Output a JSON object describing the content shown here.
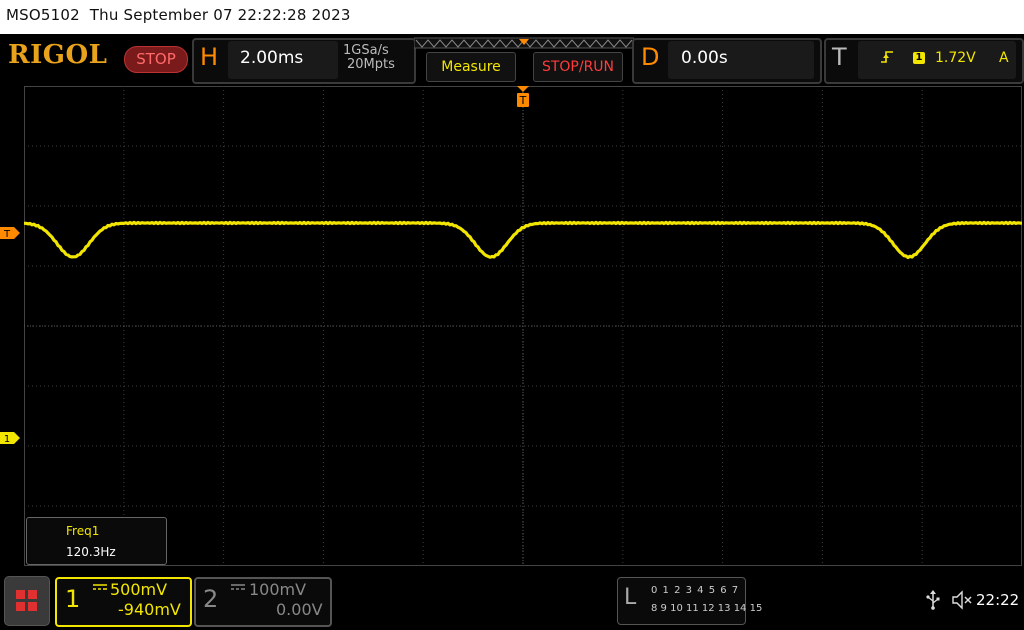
{
  "titlebar": {
    "model": "MSO5102",
    "datetime": "Thu September 07 22:22:28 2023"
  },
  "header": {
    "logo": "RIGOL",
    "run_state": "STOP",
    "horizontal": {
      "letter": "H",
      "timebase": "2.00ms",
      "sample_rate": "1GSa/s",
      "memory_depth": "20Mpts"
    },
    "measure_label": "Measure",
    "stop_run_label": "STOP/RUN",
    "delay": {
      "letter": "D",
      "value": "0.00s"
    },
    "trigger": {
      "letter": "T",
      "edge_icon": "rising-edge-icon",
      "source": "1",
      "level": "1.72V",
      "mode": "A"
    }
  },
  "display": {
    "trigger_marker_label": "T",
    "ch1_marker_label": "1",
    "trace_color": "#f2e600",
    "grid_divisions": {
      "horizontal": 10,
      "vertical": 8
    }
  },
  "measurement": {
    "name": "Freq1",
    "value": "120.3Hz"
  },
  "channels": [
    {
      "number": "1",
      "coupling_icon": "dc-coupling-icon",
      "scale": "500mV",
      "offset": "-940mV",
      "active": true,
      "color": "#f2e600"
    },
    {
      "number": "2",
      "coupling_icon": "dc-coupling-icon",
      "scale": "100mV",
      "offset": "0.00V",
      "active": false,
      "color": "#888888"
    }
  ],
  "logic_analyzer": {
    "letter": "L",
    "row1": "0 1 2 3   4 5 6 7",
    "row2": "8 9 10 11 12 13 14 15"
  },
  "status": {
    "usb_icon": "usb-icon",
    "speaker_icon": "speaker-muted-icon",
    "clock": "22:22"
  },
  "colors": {
    "accent_orange": "#ff8a00",
    "channel1_yellow": "#f2e600",
    "stop_red": "#ff3b3b"
  }
}
